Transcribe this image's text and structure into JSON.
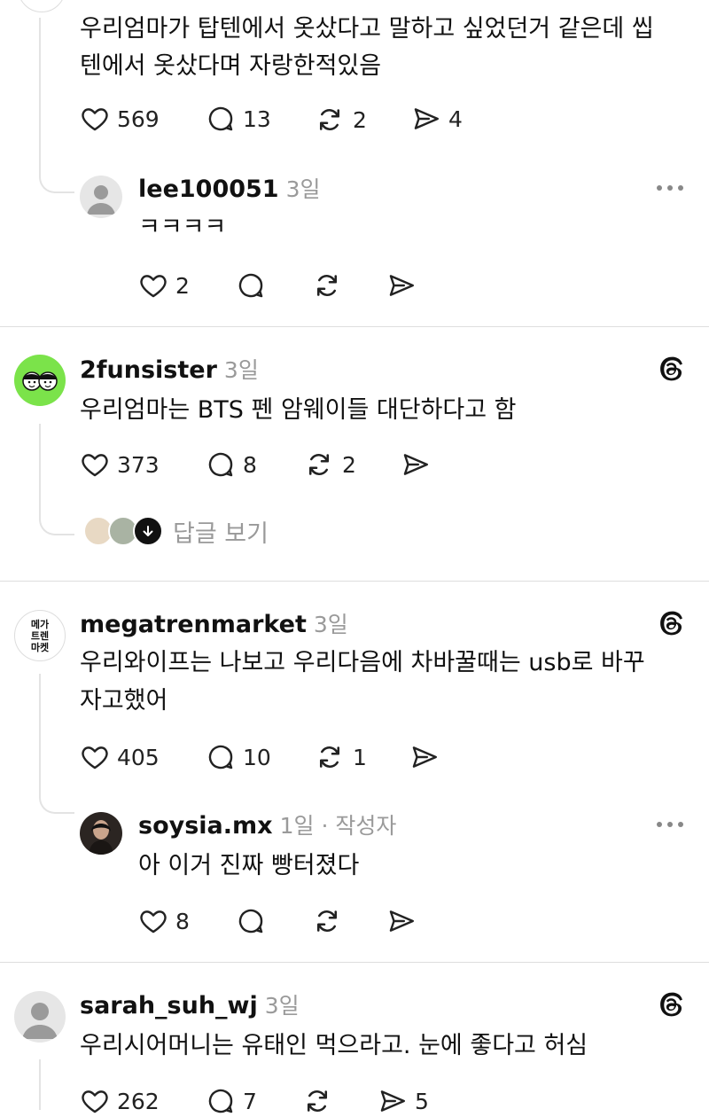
{
  "posts": [
    {
      "text_lines": [
        "우리엄마가 탑텐에서 옷샀다고 말하고 싶었던거 같은데 씹",
        "텐에서 옷샀다며 자랑한적있음"
      ],
      "likes": "569",
      "comments": "13",
      "reposts": "2",
      "shares": "4"
    },
    {
      "username": "lee100051",
      "time": "3일",
      "text": "ㅋㅋㅋㅋ",
      "likes": "2"
    },
    {
      "username": "2funsister",
      "time": "3일",
      "text": "우리엄마는 BTS 펜 암웨이들 대단하다고 함",
      "likes": "373",
      "comments": "8",
      "reposts": "2",
      "view_replies": "답글 보기"
    },
    {
      "username": "megatrenmarket",
      "time": "3일",
      "avatar_text": [
        "메가",
        "트렌",
        "마켓"
      ],
      "text_lines": [
        "우리와이프는 나보고 우리다음에 차바꿀때는 usb로 바꾸",
        "자고했어"
      ],
      "likes": "405",
      "comments": "10",
      "reposts": "1"
    },
    {
      "username": "soysia.mx",
      "time": "1일",
      "author_tag": "· 작성자",
      "text": "아 이거 진짜 빵터졌다",
      "likes": "8"
    },
    {
      "username": "sarah_suh_wj",
      "time": "3일",
      "text": "우리시어머니는 유태인 먹으라고. 눈에 좋다고 허심",
      "likes": "262",
      "comments": "7",
      "shares": "5"
    }
  ],
  "colors": {
    "text": "#111111",
    "muted": "#9a9a9a",
    "divider": "#dedede",
    "line": "#e3e3e3",
    "green_avatar": "#7be34a"
  },
  "icons": [
    "heart-icon",
    "comment-icon",
    "repost-icon",
    "share-icon",
    "more-icon",
    "threads-logo-icon",
    "arrow-down-icon"
  ]
}
